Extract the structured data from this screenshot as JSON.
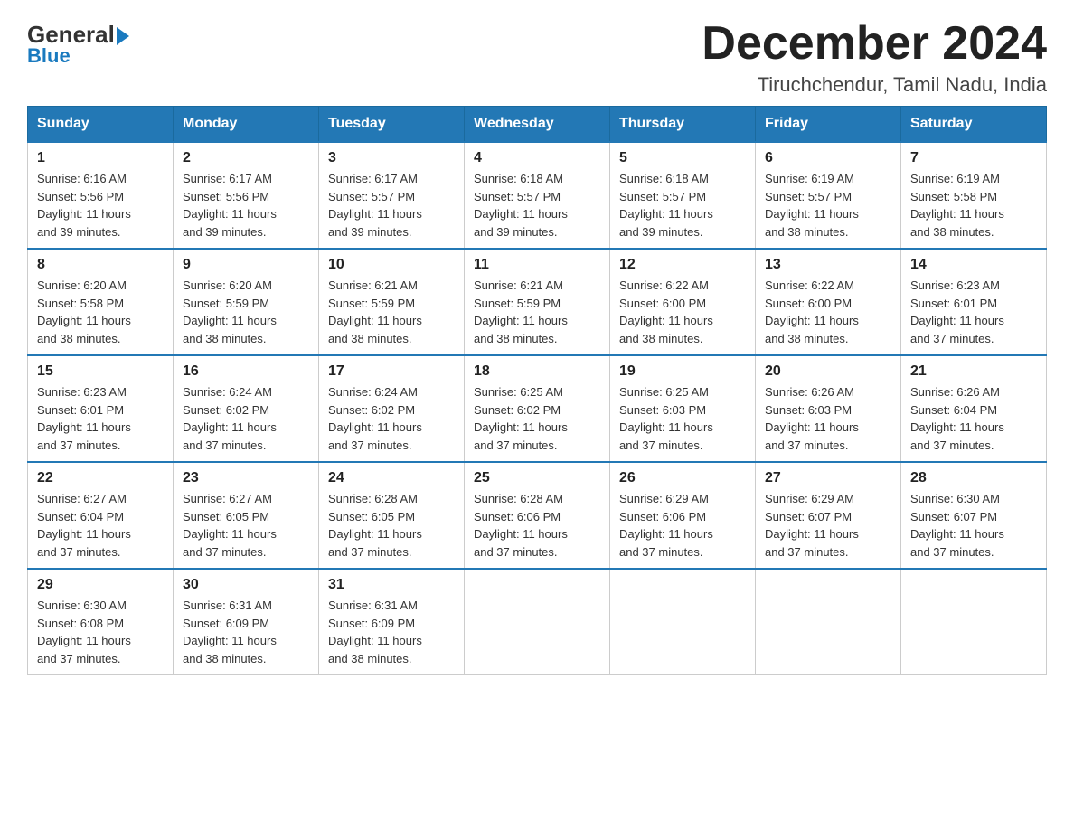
{
  "header": {
    "logo_general": "General",
    "logo_blue": "Blue",
    "month_title": "December 2024",
    "location": "Tiruchchendur, Tamil Nadu, India"
  },
  "days_of_week": [
    "Sunday",
    "Monday",
    "Tuesday",
    "Wednesday",
    "Thursday",
    "Friday",
    "Saturday"
  ],
  "weeks": [
    [
      {
        "day": "1",
        "sunrise": "6:16 AM",
        "sunset": "5:56 PM",
        "daylight": "11 hours and 39 minutes."
      },
      {
        "day": "2",
        "sunrise": "6:17 AM",
        "sunset": "5:56 PM",
        "daylight": "11 hours and 39 minutes."
      },
      {
        "day": "3",
        "sunrise": "6:17 AM",
        "sunset": "5:57 PM",
        "daylight": "11 hours and 39 minutes."
      },
      {
        "day": "4",
        "sunrise": "6:18 AM",
        "sunset": "5:57 PM",
        "daylight": "11 hours and 39 minutes."
      },
      {
        "day": "5",
        "sunrise": "6:18 AM",
        "sunset": "5:57 PM",
        "daylight": "11 hours and 39 minutes."
      },
      {
        "day": "6",
        "sunrise": "6:19 AM",
        "sunset": "5:57 PM",
        "daylight": "11 hours and 38 minutes."
      },
      {
        "day": "7",
        "sunrise": "6:19 AM",
        "sunset": "5:58 PM",
        "daylight": "11 hours and 38 minutes."
      }
    ],
    [
      {
        "day": "8",
        "sunrise": "6:20 AM",
        "sunset": "5:58 PM",
        "daylight": "11 hours and 38 minutes."
      },
      {
        "day": "9",
        "sunrise": "6:20 AM",
        "sunset": "5:59 PM",
        "daylight": "11 hours and 38 minutes."
      },
      {
        "day": "10",
        "sunrise": "6:21 AM",
        "sunset": "5:59 PM",
        "daylight": "11 hours and 38 minutes."
      },
      {
        "day": "11",
        "sunrise": "6:21 AM",
        "sunset": "5:59 PM",
        "daylight": "11 hours and 38 minutes."
      },
      {
        "day": "12",
        "sunrise": "6:22 AM",
        "sunset": "6:00 PM",
        "daylight": "11 hours and 38 minutes."
      },
      {
        "day": "13",
        "sunrise": "6:22 AM",
        "sunset": "6:00 PM",
        "daylight": "11 hours and 38 minutes."
      },
      {
        "day": "14",
        "sunrise": "6:23 AM",
        "sunset": "6:01 PM",
        "daylight": "11 hours and 37 minutes."
      }
    ],
    [
      {
        "day": "15",
        "sunrise": "6:23 AM",
        "sunset": "6:01 PM",
        "daylight": "11 hours and 37 minutes."
      },
      {
        "day": "16",
        "sunrise": "6:24 AM",
        "sunset": "6:02 PM",
        "daylight": "11 hours and 37 minutes."
      },
      {
        "day": "17",
        "sunrise": "6:24 AM",
        "sunset": "6:02 PM",
        "daylight": "11 hours and 37 minutes."
      },
      {
        "day": "18",
        "sunrise": "6:25 AM",
        "sunset": "6:02 PM",
        "daylight": "11 hours and 37 minutes."
      },
      {
        "day": "19",
        "sunrise": "6:25 AM",
        "sunset": "6:03 PM",
        "daylight": "11 hours and 37 minutes."
      },
      {
        "day": "20",
        "sunrise": "6:26 AM",
        "sunset": "6:03 PM",
        "daylight": "11 hours and 37 minutes."
      },
      {
        "day": "21",
        "sunrise": "6:26 AM",
        "sunset": "6:04 PM",
        "daylight": "11 hours and 37 minutes."
      }
    ],
    [
      {
        "day": "22",
        "sunrise": "6:27 AM",
        "sunset": "6:04 PM",
        "daylight": "11 hours and 37 minutes."
      },
      {
        "day": "23",
        "sunrise": "6:27 AM",
        "sunset": "6:05 PM",
        "daylight": "11 hours and 37 minutes."
      },
      {
        "day": "24",
        "sunrise": "6:28 AM",
        "sunset": "6:05 PM",
        "daylight": "11 hours and 37 minutes."
      },
      {
        "day": "25",
        "sunrise": "6:28 AM",
        "sunset": "6:06 PM",
        "daylight": "11 hours and 37 minutes."
      },
      {
        "day": "26",
        "sunrise": "6:29 AM",
        "sunset": "6:06 PM",
        "daylight": "11 hours and 37 minutes."
      },
      {
        "day": "27",
        "sunrise": "6:29 AM",
        "sunset": "6:07 PM",
        "daylight": "11 hours and 37 minutes."
      },
      {
        "day": "28",
        "sunrise": "6:30 AM",
        "sunset": "6:07 PM",
        "daylight": "11 hours and 37 minutes."
      }
    ],
    [
      {
        "day": "29",
        "sunrise": "6:30 AM",
        "sunset": "6:08 PM",
        "daylight": "11 hours and 37 minutes."
      },
      {
        "day": "30",
        "sunrise": "6:31 AM",
        "sunset": "6:09 PM",
        "daylight": "11 hours and 38 minutes."
      },
      {
        "day": "31",
        "sunrise": "6:31 AM",
        "sunset": "6:09 PM",
        "daylight": "11 hours and 38 minutes."
      },
      null,
      null,
      null,
      null
    ]
  ],
  "labels": {
    "sunrise": "Sunrise:",
    "sunset": "Sunset:",
    "daylight": "Daylight:"
  }
}
